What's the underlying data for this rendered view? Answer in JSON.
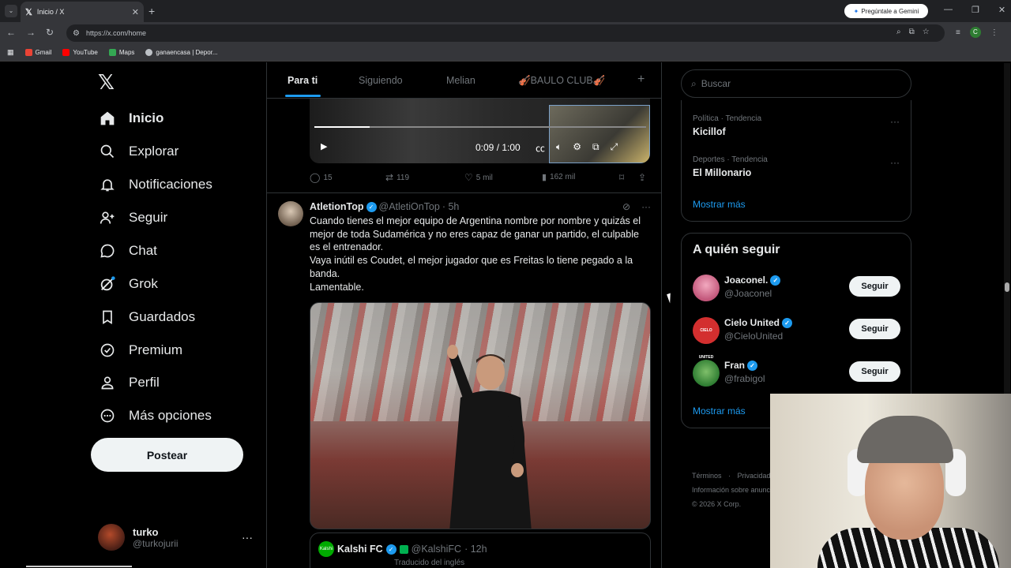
{
  "browser": {
    "tab_title": "Inicio / X",
    "tab_icon": "x-logo-icon",
    "gemini_label": "Pregúntale a Gemini",
    "url": "https://x.com/home",
    "bookmarks": [
      {
        "label": "Gmail",
        "color": "#ea4335"
      },
      {
        "label": "YouTube",
        "color": "#ff0000"
      },
      {
        "label": "Maps",
        "color": "#34a853"
      },
      {
        "label": "ganaencasa | Depor...",
        "color": "#bdc1c6"
      }
    ]
  },
  "nav": {
    "logo": "𝕏",
    "items": [
      {
        "label": "Inicio",
        "icon": "home-icon",
        "active": true
      },
      {
        "label": "Explorar",
        "icon": "search-icon"
      },
      {
        "label": "Notificaciones",
        "icon": "bell-icon"
      },
      {
        "label": "Seguir",
        "icon": "follow-icon"
      },
      {
        "label": "Chat",
        "icon": "chat-icon"
      },
      {
        "label": "Grok",
        "icon": "grok-icon"
      },
      {
        "label": "Guardados",
        "icon": "bookmark-icon"
      },
      {
        "label": "Premium",
        "icon": "premium-icon"
      },
      {
        "label": "Perfil",
        "icon": "profile-icon"
      },
      {
        "label": "Más opciones",
        "icon": "more-options-icon"
      }
    ],
    "post_button": "Postear",
    "account": {
      "name": "turko",
      "handle": "@turkojurii"
    }
  },
  "feed": {
    "tabs": [
      "Para ti",
      "Siguiendo",
      "Melian",
      "🎻BAULO CLUB🎻"
    ],
    "video": {
      "time": "0:09 / 1:00"
    },
    "prev_post_actions": {
      "replies": "15",
      "reposts": "119",
      "likes": "5 mil",
      "views": "162 mil"
    },
    "post": {
      "name": "AtletionTop",
      "handle": "@AtletiOnTop",
      "time": "· 5h",
      "text_lines": [
        "Cuando tienes el mejor equipo de Argentina nombre por nombre y quizás el mejor de toda Sudamérica y no eres capaz de ganar un partido, el culpable es el entrenador.",
        "Vaya inútil es Coudet, el mejor jugador que es Freitas lo tiene pegado a la banda.",
        "Lamentable."
      ]
    },
    "quote": {
      "name": "Kalshi FC",
      "handle": "@KalshiFC",
      "time": "· 12h",
      "avatar_text": "Kalshi",
      "translation": "Traducido del inglés"
    }
  },
  "sidebar": {
    "search_placeholder": "Buscar",
    "trends": [
      {
        "meta": "Política · Tendencia",
        "name": "Kicillof"
      },
      {
        "meta": "Deportes · Tendencia",
        "name": "El Millonario"
      }
    ],
    "trends_more": "Mostrar más",
    "who_to_follow_title": "A quién seguir",
    "who_to_follow": [
      {
        "name": "Joaconel.",
        "handle": "@Joaconel",
        "button": "Seguir",
        "avatar_color": "#c2567a"
      },
      {
        "name": "Cielo United",
        "handle": "@CieloUnited",
        "button": "Seguir",
        "avatar_color": "#d32f2f",
        "avatar_text": "CIELO UNITED"
      },
      {
        "name": "Fran",
        "handle": "@frabigol",
        "button": "Seguir",
        "avatar_color": "#2e7d32"
      }
    ],
    "who_more": "Mostrar más",
    "footer": {
      "links": [
        "Términos",
        "Privacidad"
      ],
      "ads": "Información sobre anuncios",
      "copyright": "© 2026 X Corp."
    }
  }
}
